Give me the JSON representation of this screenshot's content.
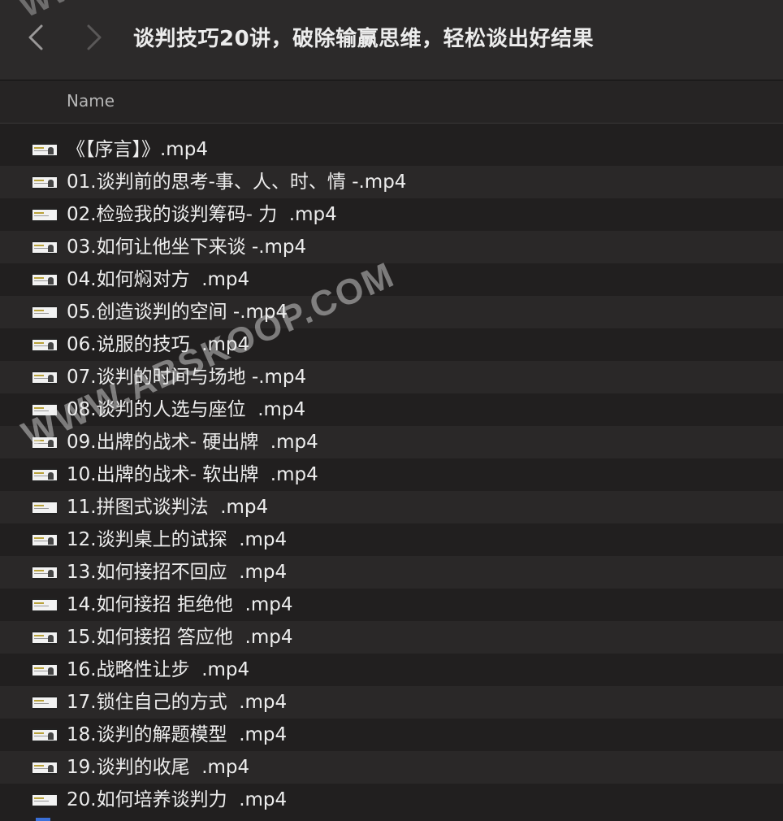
{
  "window": {
    "title": "谈判技巧20讲，破除输赢思维，轻松谈出好结果"
  },
  "toolbar": {
    "back_icon": "chevron-left-icon",
    "forward_icon": "chevron-right-icon"
  },
  "columns": {
    "name_header": "Name"
  },
  "files": [
    {
      "name": "《【序言】》.mp4",
      "thumb": "video-thumbnail-icon"
    },
    {
      "name": "01.谈判前的思考-事、人、时、情 -.mp4",
      "thumb": "video-thumbnail-icon"
    },
    {
      "name": "02.检验我的谈判筹码- 力  .mp4",
      "thumb": "video-thumbnail-icon"
    },
    {
      "name": "03.如何让他坐下来谈 -.mp4",
      "thumb": "video-thumbnail-icon"
    },
    {
      "name": "04.如何焖对方  .mp4",
      "thumb": "video-thumbnail-icon"
    },
    {
      "name": "05.创造谈判的空间 -.mp4",
      "thumb": "video-thumbnail-icon"
    },
    {
      "name": "06.说服的技巧  .mp4",
      "thumb": "video-thumbnail-icon"
    },
    {
      "name": "07.谈判的时间与场地 -.mp4",
      "thumb": "video-thumbnail-icon"
    },
    {
      "name": "08.谈判的人选与座位  .mp4",
      "thumb": "video-thumbnail-icon"
    },
    {
      "name": "09.出牌的战术- 硬出牌  .mp4",
      "thumb": "video-thumbnail-icon"
    },
    {
      "name": "10.出牌的战术- 软出牌  .mp4",
      "thumb": "video-thumbnail-icon"
    },
    {
      "name": "11.拼图式谈判法  .mp4",
      "thumb": "video-thumbnail-icon"
    },
    {
      "name": "12.谈判桌上的试探  .mp4",
      "thumb": "video-thumbnail-icon"
    },
    {
      "name": "13.如何接招不回应  .mp4",
      "thumb": "video-thumbnail-icon"
    },
    {
      "name": "14.如何接招 拒绝他  .mp4",
      "thumb": "video-thumbnail-icon"
    },
    {
      "name": "15.如何接招 答应他  .mp4",
      "thumb": "video-thumbnail-icon"
    },
    {
      "name": "16.战略性让步  .mp4",
      "thumb": "video-thumbnail-icon"
    },
    {
      "name": "17.锁住自己的方式  .mp4",
      "thumb": "video-thumbnail-icon"
    },
    {
      "name": "18.谈判的解题模型  .mp4",
      "thumb": "video-thumbnail-icon"
    },
    {
      "name": "19.谈判的收尾  .mp4",
      "thumb": "video-thumbnail-icon"
    },
    {
      "name": "20.如何培养谈判力  .mp4",
      "thumb": "video-thumbnail-icon"
    }
  ],
  "watermark": {
    "text": "WWW.ABSKOOP.COM",
    "top_fragment": "WWW"
  },
  "colors": {
    "background": "#211f1f",
    "titlebar": "#2c2a2a",
    "row_alt": "#2a2828",
    "text": "#ededed",
    "header_text": "#b5b5b5"
  }
}
